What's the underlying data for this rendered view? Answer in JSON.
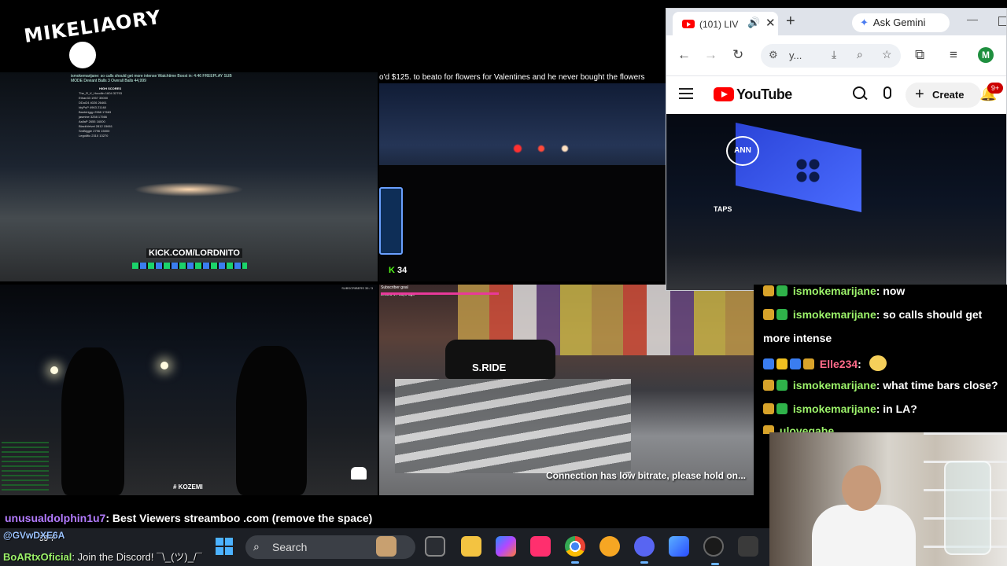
{
  "logo": {
    "text": "MIKELIAORY"
  },
  "feed_top_left": {
    "hud": "ismokemarijane: so calls should get more intense   Watchtime Boost in: 4:46   FREEPLAY   SUB MODE   Deviant Balls 3   Overall Balls 44,999",
    "scores_title": "HIGH SCORES",
    "scores": [
      "The_R_K_Hoodlin  1604 32793",
      "Ethan33  1957 35000",
      "DDui24  4026 26461",
      "IdyPuP  4963 21148",
      "Banbiriggy  2968 17663",
      "jasmine  3258 17566",
      "AsifaP  2655 16000",
      "BlackVelvet  2812 15661",
      "SmBiggie  2796 15000",
      "LegoMic  2310 13270"
    ],
    "kick_url": "KICK.COM/LORDNITO"
  },
  "feed_top_right": {
    "ticker": "o'd $125. to beato for flowers for Valentines and he never bought the flowers",
    "viewers": "34"
  },
  "feed_bottom_left": {
    "subs": "SUBSCRIBERS 35 / 3",
    "tag": "# KOZEMI"
  },
  "feed_bottom_right": {
    "top_line_1": "Subscriber goal",
    "top_line_2": "Ended 14 days ago",
    "taxi_text": "S.RIDE",
    "bitrate_notice": "Connection has low bitrate, please hold on..."
  },
  "browser": {
    "tab_title": "(101) LIV",
    "new_tab": "+",
    "gemini_label": "Ask Gemini",
    "url": "y...",
    "avatar_letter": "M",
    "yt_logo_text": "YouTube",
    "create_label": "Create",
    "notif_badge": "9+",
    "video": {
      "channel_logo": "ANN",
      "sign": "TAPS"
    }
  },
  "chat": [
    {
      "user": "ismokemarijane",
      "message": "now",
      "badge": "gold"
    },
    {
      "user": "ismokemarijane",
      "message": "so calls should get",
      "badge": "gold"
    },
    {
      "user": "",
      "message": "more intense",
      "badge": ""
    },
    {
      "user": "Elle234",
      "message": "",
      "badge": "multi"
    },
    {
      "user": "ismokemarijane",
      "message": "what time bars close?",
      "badge": "gold"
    },
    {
      "user": "ismokemarijane",
      "message": "in LA?",
      "badge": "gold"
    },
    {
      "user": "ulovegabe",
      "message": "",
      "badge": "gold"
    }
  ],
  "promo": {
    "user": "unusualdolphin1u7",
    "message": ": Best Viewers streamboo .com (remove the space)"
  },
  "bottom_chat": {
    "line1_user": "@GVwDXE6A",
    "weather": "59°F",
    "line2_user": "BoARtxOficial",
    "line2_msg": ": Join the Discord!  ¯\\_(ツ)_/¯"
  },
  "taskbar": {
    "search_label": "Search"
  }
}
